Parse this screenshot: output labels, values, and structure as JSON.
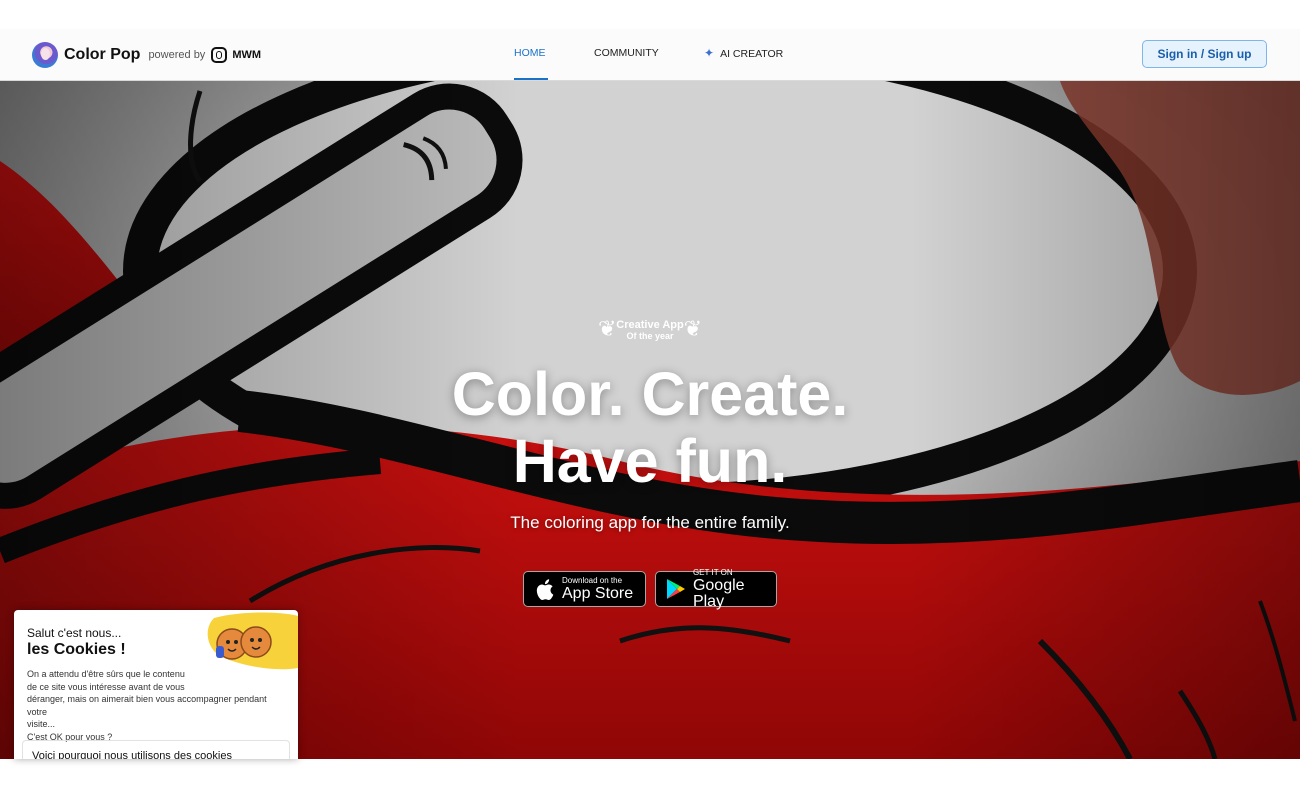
{
  "header": {
    "app_name": "Color Pop",
    "powered_by": "powered by",
    "partner": "MWM",
    "nav": [
      {
        "label": "Home",
        "active": true
      },
      {
        "label": "Community",
        "active": false
      },
      {
        "label": "AI Creator",
        "active": false,
        "icon": "magic-wand-icon"
      }
    ],
    "signin_label": "Sign in / Sign up"
  },
  "hero": {
    "badge_line1": "Creative App",
    "badge_line2": "Of the year",
    "headline_line1": "Color. Create.",
    "headline_line2": "Have fun.",
    "subhead": "The coloring app for the entire family.",
    "app_store": {
      "small": "Download on the",
      "big": "App Store"
    },
    "google_play": {
      "small": "GET IT ON",
      "big": "Google Play"
    }
  },
  "cookie": {
    "hello": "Salut c'est nous...",
    "title": "les Cookies !",
    "body_lines": [
      "On a attendu d'être sûrs que le contenu",
      "de ce site vous intéresse avant de vous",
      "déranger, mais on aimerait bien vous accompagner pendant votre",
      "visite...",
      "C'est OK pour vous ?"
    ],
    "why_label": "Voici pourquoi nous utilisons des cookies"
  },
  "colors": {
    "accent": "#1a73c9",
    "signin_bg": "#e6f2fc",
    "hero_red": "#c40d0d"
  }
}
